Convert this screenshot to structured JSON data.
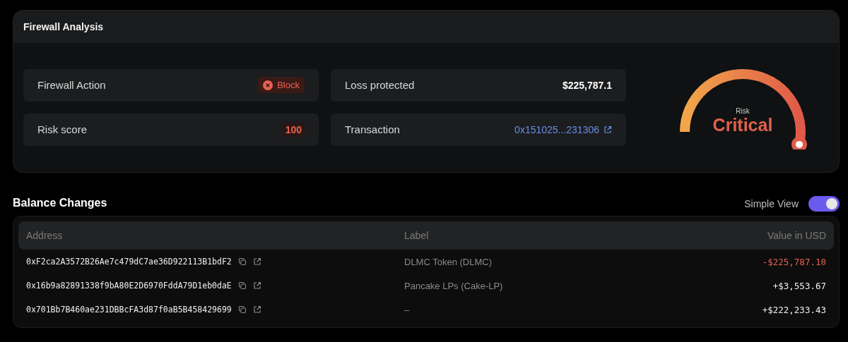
{
  "firewall": {
    "title": "Firewall Analysis",
    "fields": [
      {
        "label": "Firewall Action",
        "kind": "badge",
        "value": "Block"
      },
      {
        "label": "Loss protected",
        "kind": "amount",
        "value": "$225,787.1"
      },
      {
        "label": "Risk score",
        "kind": "score",
        "value": "100"
      },
      {
        "label": "Transaction",
        "kind": "link",
        "value": "0x151025...231306"
      }
    ],
    "gauge": {
      "caption": "Risk",
      "value": "Critical"
    }
  },
  "balance": {
    "title": "Balance Changes",
    "toggle": {
      "label": "Simple View",
      "on": true
    },
    "columns": [
      "Address",
      "Label",
      "Value in USD"
    ],
    "rows": [
      {
        "address": "0xF2ca2A3572B26Ae7c479dC7ae36D922113B1bdF2",
        "label": "DLMC Token (DLMC)",
        "value": "-$225,787.10",
        "kind": "negative"
      },
      {
        "address": "0x16b9a82891338f9bA80E2D6970FddA79D1eb0daE",
        "label": "Pancake LPs (Cake-LP)",
        "value": "+$3,553.67",
        "kind": "positive"
      },
      {
        "address": "0x701Bb7B460ae231DBBcFA3d87f0aB5B458429699",
        "label": "–",
        "value": "+$222,233.43",
        "kind": "positive"
      }
    ]
  }
}
